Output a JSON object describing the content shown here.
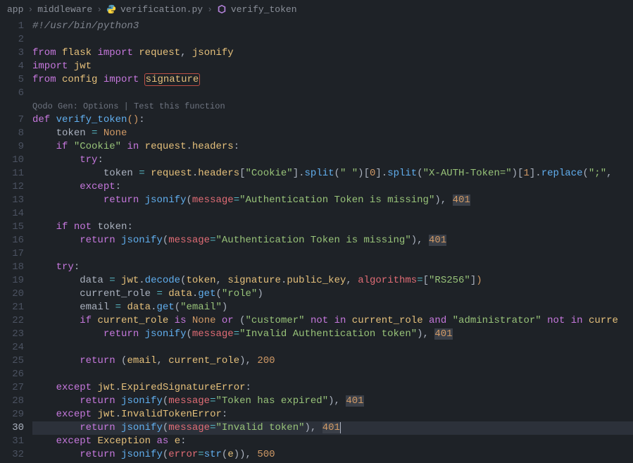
{
  "breadcrumb": {
    "parts": [
      "app",
      "middleware",
      "verification.py",
      "verify_token"
    ]
  },
  "codelens": "Qodo Gen: Options | Test this function",
  "active_line": 30,
  "lines": [
    {
      "n": 1,
      "html": "<span class='c'>#!/usr/bin/python3</span>"
    },
    {
      "n": 2,
      "html": ""
    },
    {
      "n": 3,
      "html": "<span class='k'>from</span> <span class='v'>flask</span> <span class='k'>import</span> <span class='v'>request</span><span class='p'>,</span> <span class='v'>jsonify</span>"
    },
    {
      "n": 4,
      "html": "<span class='k'>import</span> <span class='v'>jwt</span>"
    },
    {
      "n": 5,
      "html": "<span class='k'>from</span> <span class='v'>config</span> <span class='k'>import</span> <span class='v hl-box'>signature</span>"
    },
    {
      "n": 6,
      "html": ""
    },
    {
      "n": 7,
      "html": "<span class='k'>def</span> <span class='fn-def'>verify_token</span><span class='n'>()</span><span class='p'>:</span>",
      "codelens_before": true
    },
    {
      "n": 8,
      "html": "    <span class='p'>token</span> <span class='op'>=</span> <span class='none'>None</span>"
    },
    {
      "n": 9,
      "html": "    <span class='k'>if</span> <span class='s'>\"Cookie\"</span> <span class='k'>in</span> <span class='v'>request</span><span class='p'>.</span><span class='v'>headers</span><span class='p'>:</span>"
    },
    {
      "n": 10,
      "html": "        <span class='k'>try</span><span class='p'>:</span>"
    },
    {
      "n": 11,
      "html": "            <span class='p'>token</span> <span class='op'>=</span> <span class='v'>request</span><span class='p'>.</span><span class='v'>headers</span><span class='p'>[</span><span class='s'>\"Cookie\"</span><span class='p'>].</span><span class='fn'>split</span><span class='p'>(</span><span class='s'>\" \"</span><span class='p'>)[</span><span class='n'>0</span><span class='p'>].</span><span class='fn'>split</span><span class='p'>(</span><span class='s'>\"X-AUTH-Token=\"</span><span class='p'>)[</span><span class='n'>1</span><span class='p'>].</span><span class='fn'>replace</span><span class='p'>(</span><span class='s'>\";\"</span><span class='p'>,</span>"
    },
    {
      "n": 12,
      "html": "        <span class='k'>except</span><span class='p'>:</span>"
    },
    {
      "n": 13,
      "html": "            <span class='k'>return</span> <span class='fn'>jsonify</span><span class='p'>(</span><span class='param'>message</span><span class='op'>=</span><span class='s'>\"Authentication Token is missing\"</span><span class='p'>),</span> <span class='n hl-bg'>401</span>"
    },
    {
      "n": 14,
      "html": ""
    },
    {
      "n": 15,
      "html": "    <span class='k'>if</span> <span class='k'>not</span> <span class='p'>token:</span>"
    },
    {
      "n": 16,
      "html": "        <span class='k'>return</span> <span class='fn'>jsonify</span><span class='p'>(</span><span class='param'>message</span><span class='op'>=</span><span class='s'>\"Authentication Token is missing\"</span><span class='p'>),</span> <span class='n hl-bg'>401</span>"
    },
    {
      "n": 17,
      "html": ""
    },
    {
      "n": 18,
      "html": "    <span class='k'>try</span><span class='p'>:</span>"
    },
    {
      "n": 19,
      "html": "        <span class='p'>data</span> <span class='op'>=</span> <span class='v'>jwt</span><span class='p'>.</span><span class='fn'>decode</span><span class='p'>(</span><span class='v'>token</span><span class='p'>,</span> <span class='v'>signature</span><span class='p'>.</span><span class='v'>public_key</span><span class='p'>,</span> <span class='param'>algorithms</span><span class='op'>=</span><span class='p'>[</span><span class='s'>\"RS256\"</span><span class='p'>]</span><span class='n'>)</span>"
    },
    {
      "n": 20,
      "html": "        <span class='p'>current_role</span> <span class='op'>=</span> <span class='v'>data</span><span class='p'>.</span><span class='fn'>get</span><span class='p'>(</span><span class='s'>\"role\"</span><span class='p'>)</span>"
    },
    {
      "n": 21,
      "html": "        <span class='p'>email</span> <span class='op'>=</span> <span class='v'>data</span><span class='p'>.</span><span class='fn'>get</span><span class='p'>(</span><span class='s'>\"email\"</span><span class='p'>)</span>"
    },
    {
      "n": 22,
      "html": "        <span class='k'>if</span> <span class='v'>current_role</span> <span class='k'>is</span> <span class='none'>None</span> <span class='k'>or</span> <span class='p'>(</span><span class='s'>\"customer\"</span> <span class='k'>not</span> <span class='k'>in</span> <span class='v'>current_role</span> <span class='k'>and</span> <span class='s'>\"administrator\"</span> <span class='k'>not</span> <span class='k'>in</span> <span class='v'>curre</span>"
    },
    {
      "n": 23,
      "html": "            <span class='k'>return</span> <span class='fn'>jsonify</span><span class='p'>(</span><span class='param'>message</span><span class='op'>=</span><span class='s'>\"Invalid Authentication token\"</span><span class='p'>),</span> <span class='n hl-bg'>401</span>"
    },
    {
      "n": 24,
      "html": ""
    },
    {
      "n": 25,
      "html": "        <span class='k'>return</span> <span class='p'>(</span><span class='v'>email</span><span class='p'>,</span> <span class='v'>current_role</span><span class='p'>),</span> <span class='n'>200</span>"
    },
    {
      "n": 26,
      "html": ""
    },
    {
      "n": 27,
      "html": "    <span class='k'>except</span> <span class='v'>jwt</span><span class='p'>.</span><span class='v'>ExpiredSignatureError</span><span class='p'>:</span>"
    },
    {
      "n": 28,
      "html": "        <span class='k'>return</span> <span class='fn'>jsonify</span><span class='p'>(</span><span class='param'>message</span><span class='op'>=</span><span class='s'>\"Token has expired\"</span><span class='p'>),</span> <span class='n hl-bg'>401</span>"
    },
    {
      "n": 29,
      "html": "    <span class='k'>except</span> <span class='v'>jwt</span><span class='p'>.</span><span class='v'>InvalidTokenError</span><span class='p'>:</span>"
    },
    {
      "n": 30,
      "html": "        <span class='k'>return</span> <span class='fn'>jsonify</span><span class='p'>(</span><span class='param'>message</span><span class='op'>=</span><span class='s'>\"Invalid token\"</span><span class='p'>),</span> <span class='n hl-bg'>401</span><span class='cursor'></span>",
      "active": true
    },
    {
      "n": 31,
      "html": "    <span class='k'>except</span> <span class='v'>Exception</span> <span class='k'>as</span> <span class='v'>e</span><span class='p'>:</span>"
    },
    {
      "n": 32,
      "html": "        <span class='k'>return</span> <span class='fn'>jsonify</span><span class='p'>(</span><span class='param'>error</span><span class='op'>=</span><span class='fn'>str</span><span class='p'>(</span><span class='v'>e</span><span class='p'>)),</span> <span class='n'>500</span>"
    }
  ]
}
